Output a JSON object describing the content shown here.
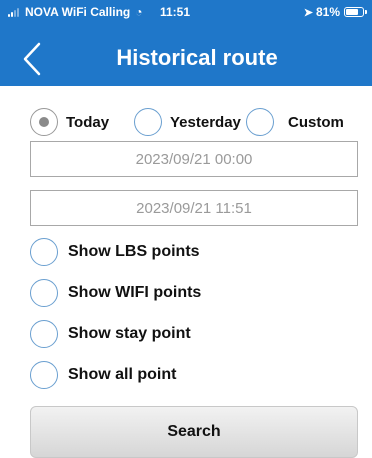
{
  "status_bar": {
    "carrier": "NOVA WiFi Calling",
    "time": "11:51",
    "battery": "81%",
    "battery_level": 0.81
  },
  "nav": {
    "title": "Historical route",
    "back_icon": "chevron-left-icon"
  },
  "date_range": {
    "options": [
      {
        "label": "Today",
        "selected": true
      },
      {
        "label": "Yesterday",
        "selected": false
      },
      {
        "label": "Custom",
        "selected": false
      }
    ],
    "start": "2023/09/21 00:00",
    "end": "2023/09/21 11:51"
  },
  "point_options": [
    {
      "label": "Show LBS points",
      "checked": false
    },
    {
      "label": "Show WIFI points",
      "checked": false
    },
    {
      "label": "Show stay point",
      "checked": false
    },
    {
      "label": "Show all point",
      "checked": false
    }
  ],
  "search_label": "Search",
  "colors": {
    "accent": "#1f77c9",
    "radio_border": "#6a9fd0",
    "field_text": "#9a9a9a"
  }
}
